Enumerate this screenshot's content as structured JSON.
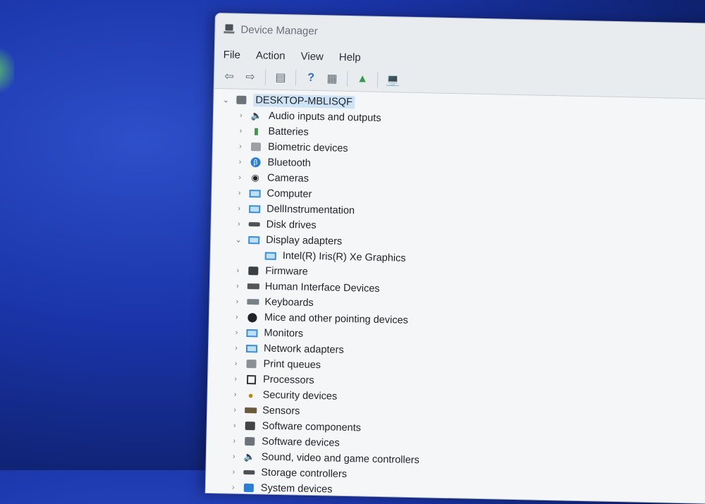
{
  "window": {
    "title": "Device Manager"
  },
  "menu": [
    "File",
    "Action",
    "View",
    "Help"
  ],
  "toolbar": {
    "icons": [
      "back-arrow-icon",
      "forward-arrow-icon",
      "properties-icon",
      "help-icon",
      "view-icon",
      "update-driver-icon",
      "scan-hardware-icon"
    ]
  },
  "tree": {
    "root": "DESKTOP-MBLISQF",
    "items": [
      {
        "label": "Audio inputs and outputs",
        "icon": "speaker-icon"
      },
      {
        "label": "Batteries",
        "icon": "battery-icon"
      },
      {
        "label": "Biometric devices",
        "icon": "fingerprint-icon"
      },
      {
        "label": "Bluetooth",
        "icon": "bluetooth-icon"
      },
      {
        "label": "Cameras",
        "icon": "camera-icon"
      },
      {
        "label": "Computer",
        "icon": "computer-icon"
      },
      {
        "label": "DellInstrumentation",
        "icon": "computer-icon"
      },
      {
        "label": "Disk drives",
        "icon": "disk-icon"
      },
      {
        "label": "Display adapters",
        "icon": "display-adapter-icon",
        "expanded": true,
        "child": "Intel(R) Iris(R) Xe Graphics"
      },
      {
        "label": "Firmware",
        "icon": "firmware-icon"
      },
      {
        "label": "Human Interface Devices",
        "icon": "hid-icon"
      },
      {
        "label": "Keyboards",
        "icon": "keyboard-icon"
      },
      {
        "label": "Mice and other pointing devices",
        "icon": "mouse-icon"
      },
      {
        "label": "Monitors",
        "icon": "monitor-icon"
      },
      {
        "label": "Network adapters",
        "icon": "network-icon"
      },
      {
        "label": "Print queues",
        "icon": "printer-icon"
      },
      {
        "label": "Processors",
        "icon": "processor-icon"
      },
      {
        "label": "Security devices",
        "icon": "security-icon"
      },
      {
        "label": "Sensors",
        "icon": "sensor-icon"
      },
      {
        "label": "Software components",
        "icon": "software-component-icon"
      },
      {
        "label": "Software devices",
        "icon": "software-device-icon"
      },
      {
        "label": "Sound, video and game controllers",
        "icon": "sound-icon"
      },
      {
        "label": "Storage controllers",
        "icon": "storage-icon"
      },
      {
        "label": "System devices",
        "icon": "system-icon"
      }
    ]
  }
}
